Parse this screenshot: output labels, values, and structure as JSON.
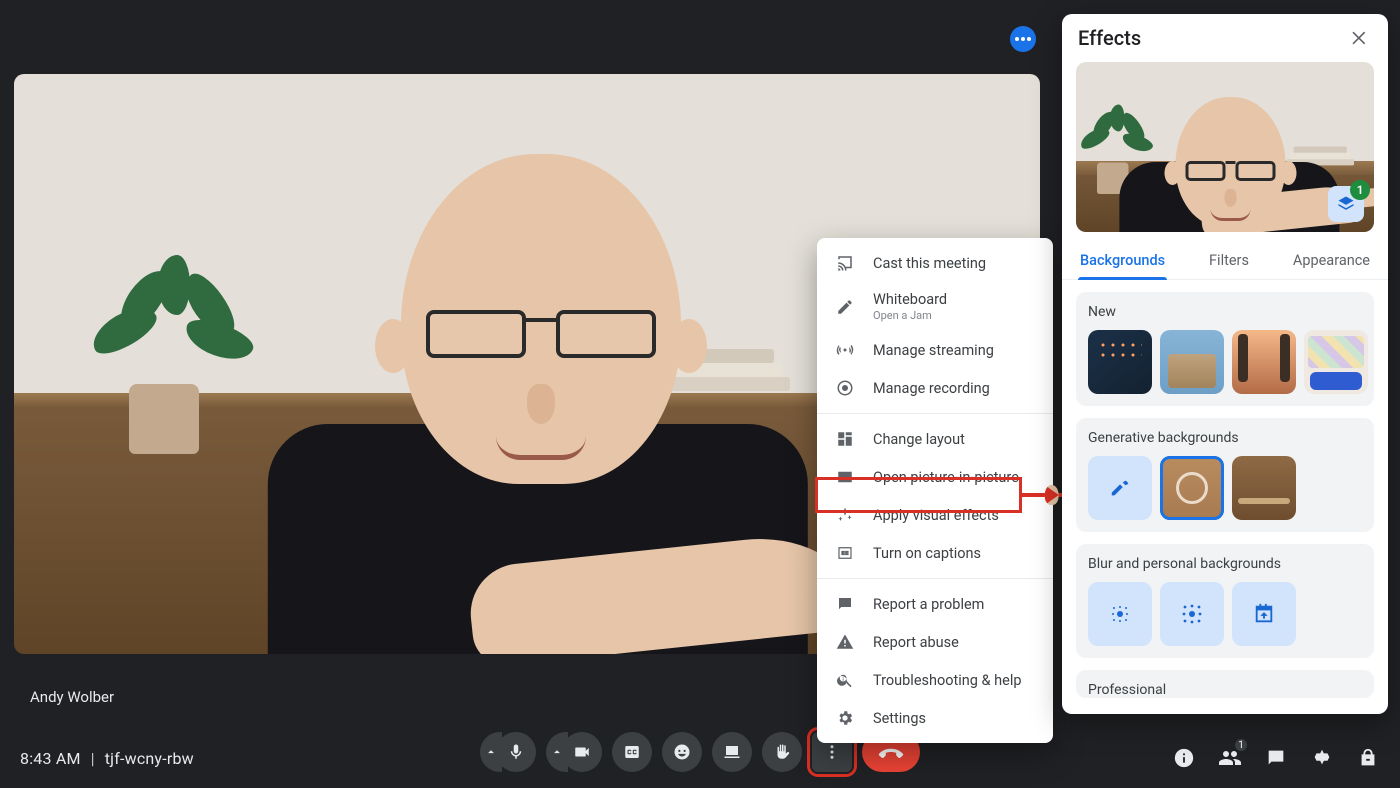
{
  "participant_name": "Andy Wolber",
  "meeting": {
    "time": "8:43 AM",
    "code": "tjf-wcny-rbw"
  },
  "people_badge": "1",
  "overflow_menu": {
    "items": [
      {
        "label": "Cast this meeting",
        "icon": "cast-icon"
      },
      {
        "label": "Whiteboard",
        "sub": "Open a Jam",
        "icon": "pencil-icon"
      },
      {
        "label": "Manage streaming",
        "icon": "stream-icon"
      },
      {
        "label": "Manage recording",
        "icon": "record-icon"
      }
    ],
    "items2": [
      {
        "label": "Change layout",
        "icon": "layout-icon"
      },
      {
        "label": "Open picture-in-picture",
        "icon": "pip-icon"
      },
      {
        "label": "Apply visual effects",
        "icon": "sparkle-icon",
        "highlight": true
      },
      {
        "label": "Turn on captions",
        "icon": "cc-icon"
      }
    ],
    "items3": [
      {
        "label": "Report a problem",
        "icon": "feedback-icon"
      },
      {
        "label": "Report abuse",
        "icon": "abuse-icon"
      },
      {
        "label": "Troubleshooting & help",
        "icon": "help-icon"
      },
      {
        "label": "Settings",
        "icon": "gear-icon"
      }
    ]
  },
  "effects_panel": {
    "title": "Effects",
    "layers_badge": "1",
    "tabs": {
      "backgrounds": "Backgrounds",
      "filters": "Filters",
      "appearance": "Appearance",
      "active": "backgrounds"
    },
    "sections": {
      "new": "New",
      "generative": "Generative backgrounds",
      "blur": "Blur and personal backgrounds",
      "professional": "Professional"
    }
  }
}
